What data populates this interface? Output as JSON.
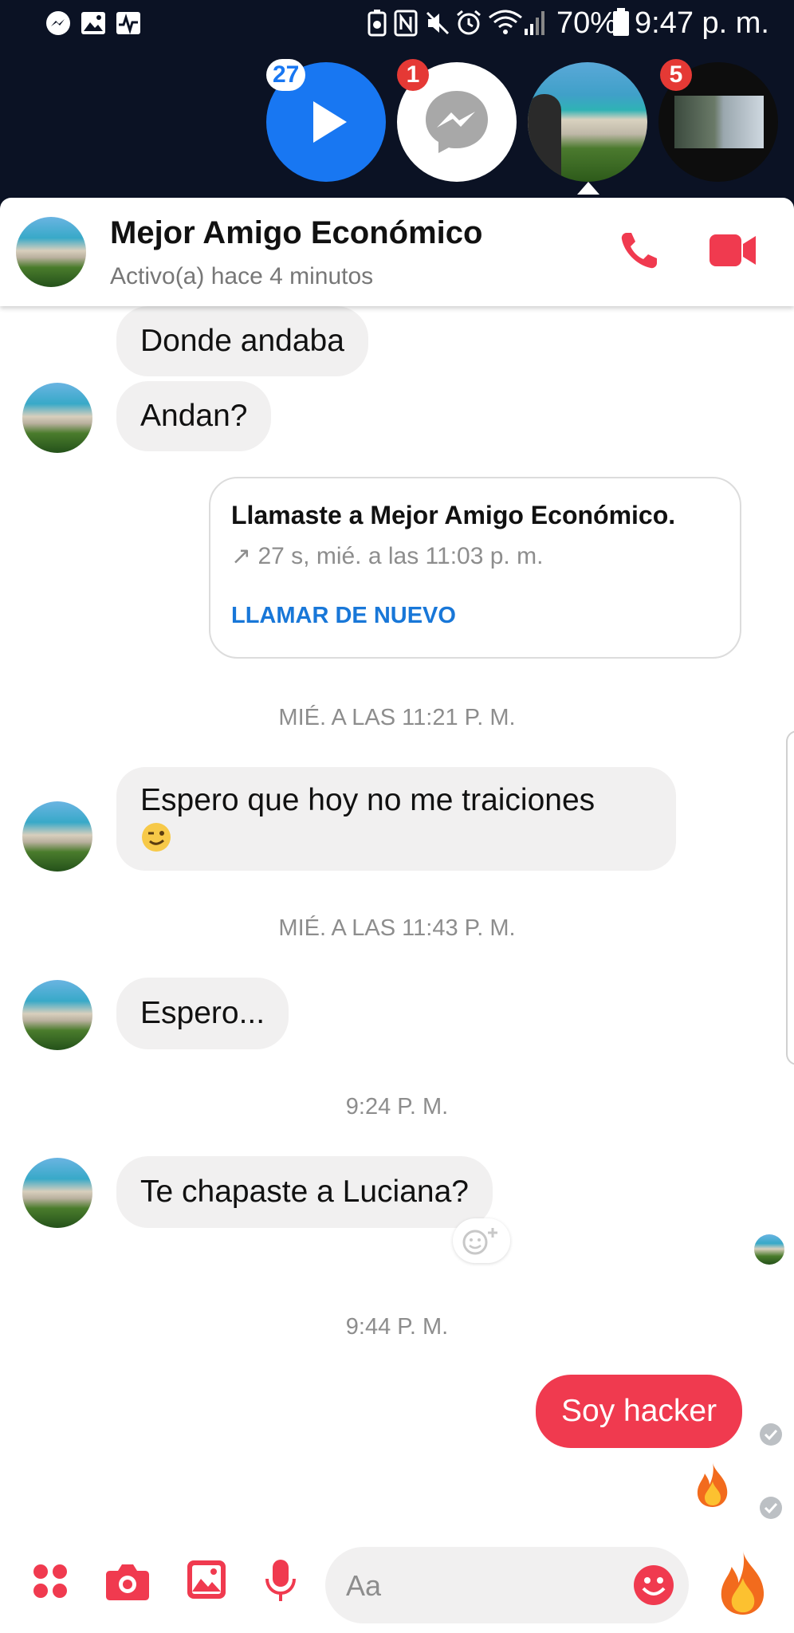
{
  "status_bar": {
    "battery_percent": "70%",
    "time": "9:47 p. m."
  },
  "chat_heads": [
    {
      "name": "video-head",
      "badge": "27"
    },
    {
      "name": "messenger-head",
      "badge": "1"
    },
    {
      "name": "beach-contact-head",
      "badge": ""
    },
    {
      "name": "group-head",
      "badge": "5"
    }
  ],
  "conversation": {
    "title": "Mejor Amigo Económico",
    "status": "Activo(a) hace 4 minutos"
  },
  "messages": {
    "m1": "Donde andaba",
    "m2": "Andan?",
    "call": {
      "title": "Llamaste a Mejor Amigo Económico.",
      "detail": "↗ 27 s, mié. a las 11:03 p. m.",
      "action": "LLAMAR DE NUEVO"
    },
    "ts1": "MIÉ. A LAS 11:21 P. M.",
    "m3_line1": "Espero que hoy no me traiciones",
    "ts2": "MIÉ. A LAS 11:43 P. M.",
    "m4": "Espero...",
    "ts3": "9:24 P. M.",
    "m5": "Te chapaste a Luciana?",
    "ts4": "9:44 P. M.",
    "m6": "Soy hacker"
  },
  "composer": {
    "placeholder": "Aa"
  },
  "colors": {
    "accent": "#f03a4f",
    "link": "#1877d8",
    "header_bg": "#0b1224"
  }
}
